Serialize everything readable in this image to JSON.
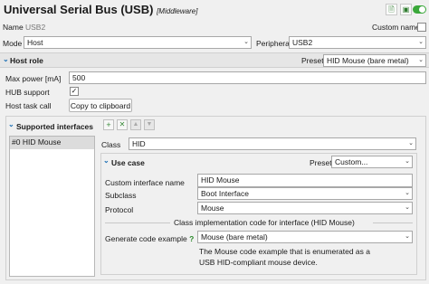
{
  "header": {
    "title": "Universal Serial Bus (USB)",
    "tag": "[Middleware]"
  },
  "name_row": {
    "name_label": "Name",
    "name_value": "USB2",
    "custom_name_label": "Custom name"
  },
  "mode_row": {
    "mode_label": "Mode",
    "mode_value": "Host",
    "peripheral_label": "Peripheral",
    "peripheral_value": "USB2"
  },
  "host_role": {
    "title": "Host role",
    "preset_label": "Preset",
    "preset_value": "HID Mouse (bare metal)",
    "max_power_label": "Max power [mA]",
    "max_power_value": "500",
    "hub_support_label": "HUB support",
    "host_task_call_label": "Host task call",
    "copy_button_label": "Copy to clipboard"
  },
  "supported_interfaces": {
    "title": "Supported interfaces",
    "add_icon": "+",
    "remove_icon": "✕",
    "up_icon": "▲",
    "down_icon": "▼",
    "items": [
      "#0 HID Mouse"
    ],
    "class_label": "Class",
    "class_value": "HID"
  },
  "use_case": {
    "title": "Use case",
    "preset_label": "Preset",
    "preset_value": "Custom...",
    "custom_interface_name_label": "Custom interface name",
    "custom_interface_name_value": "HID Mouse",
    "subclass_label": "Subclass",
    "subclass_value": "Boot Interface",
    "protocol_label": "Protocol",
    "protocol_value": "Mouse",
    "impl_code_label": "Class implementation code for interface (HID Mouse)",
    "generate_code_label": "Generate code example",
    "help_icon": "?",
    "generate_code_value": "Mouse (bare metal)",
    "description": "The Mouse code example that is enumerated as a USB HID-compliant mouse device."
  },
  "colors": {
    "accent": "#1c6fb4",
    "toggle": "#3aa83a"
  }
}
